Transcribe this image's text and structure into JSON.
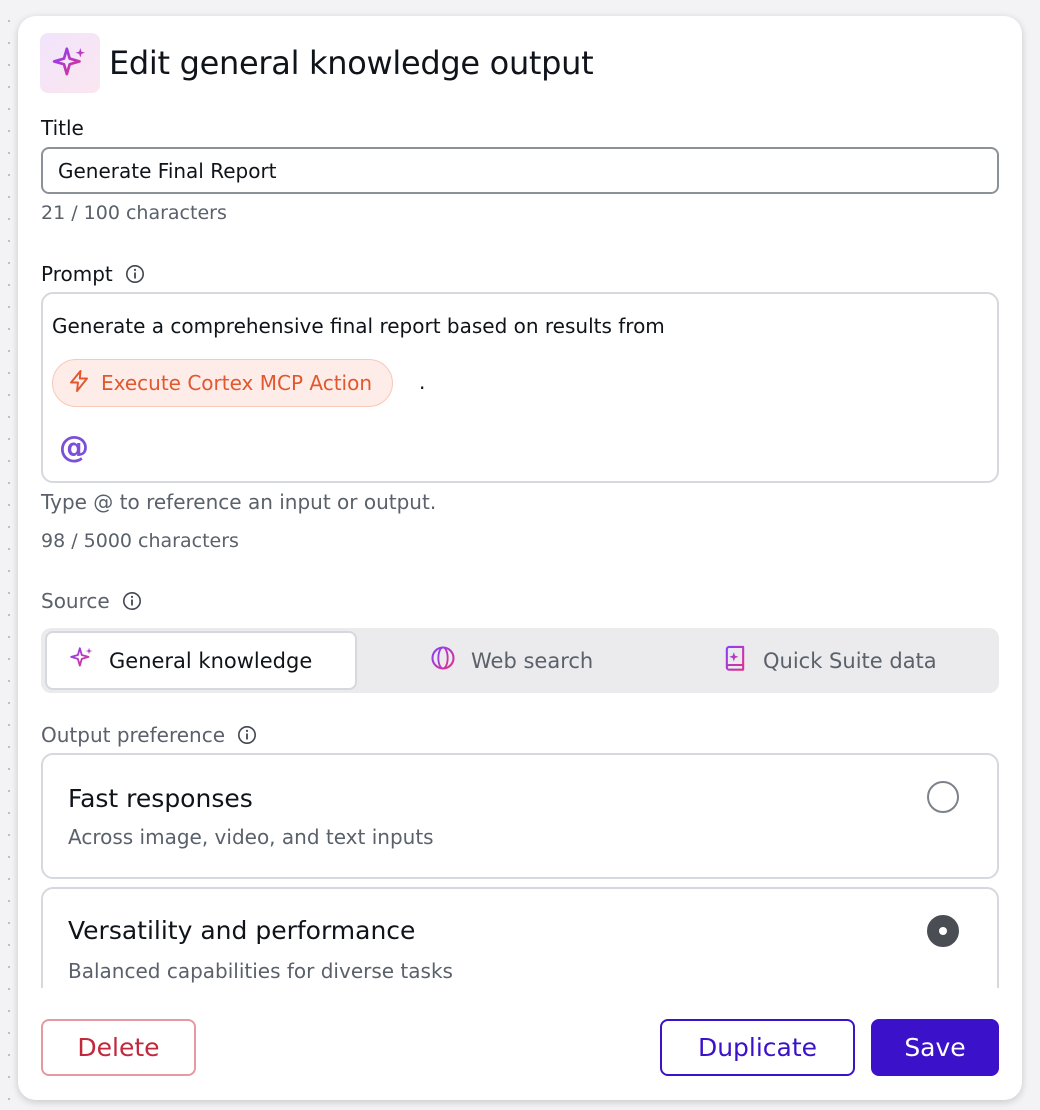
{
  "header": {
    "title": "Edit general knowledge output",
    "icon": "sparkle-icon"
  },
  "title_field": {
    "label": "Title",
    "value": "Generate Final Report",
    "counter": "21 / 100 characters"
  },
  "prompt": {
    "label": "Prompt",
    "text": "Generate a comprehensive final report based on results from",
    "reference_chip": {
      "label": "Execute Cortex MCP Action",
      "icon": "lightning-icon"
    },
    "trailing": ".",
    "at_symbol": "@",
    "helper": "Type @ to reference an input or output.",
    "counter": "98 / 5000 characters"
  },
  "source": {
    "label": "Source",
    "options": [
      {
        "label": "General knowledge",
        "icon": "sparkle-icon",
        "selected": true
      },
      {
        "label": "Web search",
        "icon": "globe-icon",
        "selected": false
      },
      {
        "label": "Quick Suite data",
        "icon": "book-icon",
        "selected": false
      }
    ]
  },
  "output_preference": {
    "label": "Output preference",
    "options": [
      {
        "title": "Fast responses",
        "description": "Across image, video, and text inputs",
        "selected": false
      },
      {
        "title": "Versatility and performance",
        "description": "Balanced capabilities for diverse tasks",
        "selected": true
      }
    ]
  },
  "footer": {
    "delete_label": "Delete",
    "duplicate_label": "Duplicate",
    "save_label": "Save"
  },
  "colors": {
    "accent": "#3b12c9",
    "danger": "#c2283b",
    "chip_text": "#e2572e",
    "sparkle": "#9b3fd6"
  }
}
